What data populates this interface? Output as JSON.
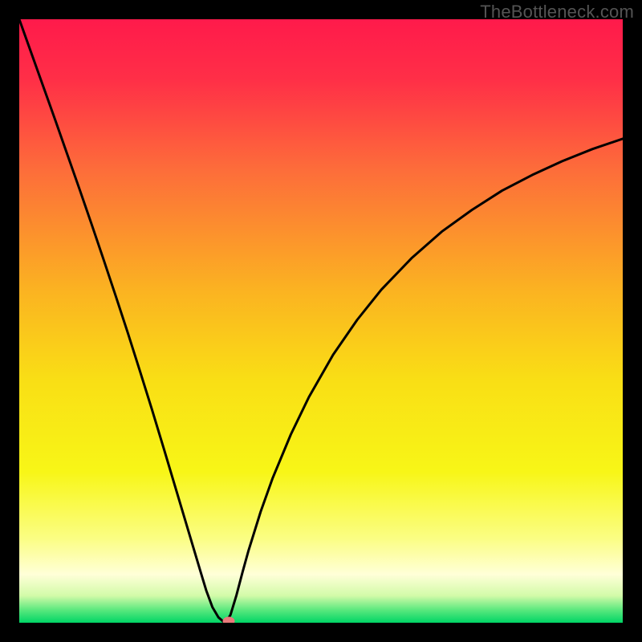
{
  "watermark": "TheBottleneck.com",
  "chart_data": {
    "type": "line",
    "title": "",
    "xlabel": "",
    "ylabel": "",
    "xlim": [
      0,
      100
    ],
    "ylim": [
      0,
      100
    ],
    "grid": false,
    "legend": false,
    "background_gradient_stops": [
      {
        "pos": 0.0,
        "color": "#ff1a4b"
      },
      {
        "pos": 0.1,
        "color": "#ff2f47"
      },
      {
        "pos": 0.25,
        "color": "#fd6d3a"
      },
      {
        "pos": 0.45,
        "color": "#fbb321"
      },
      {
        "pos": 0.6,
        "color": "#f9df15"
      },
      {
        "pos": 0.75,
        "color": "#f8f617"
      },
      {
        "pos": 0.86,
        "color": "#fbfe83"
      },
      {
        "pos": 0.92,
        "color": "#ffffd8"
      },
      {
        "pos": 0.955,
        "color": "#d3fba9"
      },
      {
        "pos": 0.98,
        "color": "#55e77c"
      },
      {
        "pos": 1.0,
        "color": "#00d566"
      }
    ],
    "series": [
      {
        "name": "bottleneck-curve",
        "color": "#000000",
        "stroke_width": 3,
        "x": [
          0.0,
          2.0,
          4.0,
          6.0,
          8.0,
          10.0,
          12.0,
          14.0,
          16.0,
          18.0,
          20.0,
          22.0,
          24.0,
          26.0,
          28.0,
          30.0,
          31.0,
          32.0,
          33.0,
          33.8,
          34.3,
          35.0,
          36.0,
          37.0,
          38.0,
          40.0,
          42.0,
          45.0,
          48.0,
          52.0,
          56.0,
          60.0,
          65.0,
          70.0,
          75.0,
          80.0,
          85.0,
          90.0,
          95.0,
          100.0
        ],
        "y": [
          100.0,
          94.4,
          88.8,
          83.2,
          77.5,
          71.8,
          66.0,
          60.1,
          54.1,
          48.0,
          41.7,
          35.3,
          28.7,
          22.0,
          15.3,
          8.6,
          5.3,
          2.6,
          0.9,
          0.2,
          0.2,
          1.3,
          4.6,
          8.4,
          12.0,
          18.4,
          24.0,
          31.2,
          37.4,
          44.4,
          50.2,
          55.2,
          60.4,
          64.8,
          68.4,
          71.6,
          74.2,
          76.5,
          78.5,
          80.2
        ]
      }
    ],
    "annotations": [
      {
        "type": "marker",
        "name": "highlight-dot",
        "shape": "ellipse",
        "color": "#e97a7b",
        "x": 34.7,
        "y": 0.3
      }
    ]
  }
}
